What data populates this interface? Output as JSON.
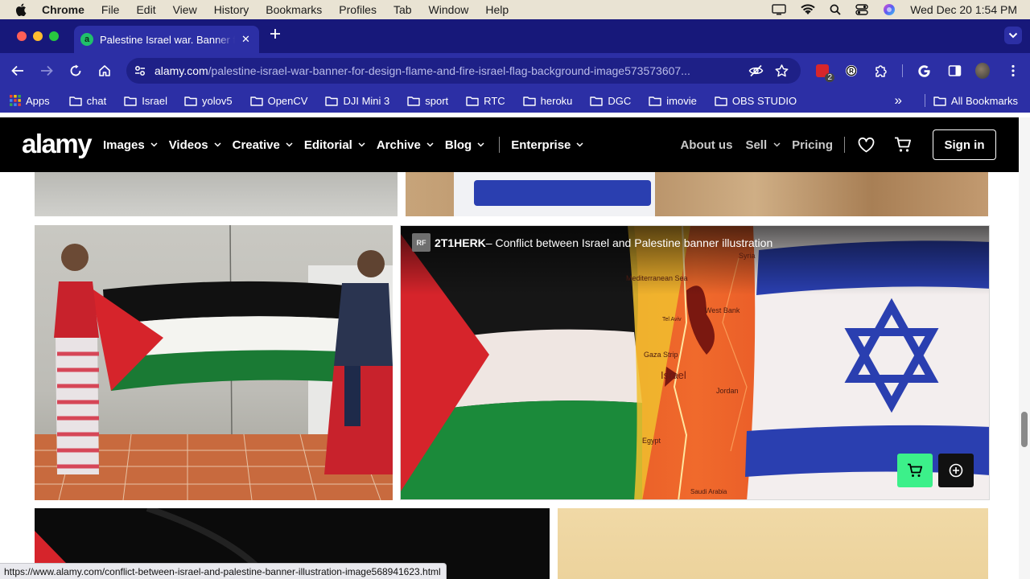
{
  "menubar": {
    "items": [
      "Chrome",
      "File",
      "Edit",
      "View",
      "History",
      "Bookmarks",
      "Profiles",
      "Tab",
      "Window",
      "Help"
    ],
    "clock": "Wed Dec 20  1:54 PM"
  },
  "tab": {
    "favicon": "a",
    "title": "Palestine Israel war. Banner for design",
    "close": "✕"
  },
  "omnibox": {
    "domain": "alamy.com",
    "path": "/palestine-israel-war-banner-for-design-flame-and-fire-israel-flag-background-image573573607..."
  },
  "extensions": {
    "badge_count": "2"
  },
  "bookmarks": {
    "apps_label": "Apps",
    "items": [
      "chat",
      "Israel",
      "yolov5",
      "OpenCV",
      "DJI Mini 3",
      "sport",
      "RTC",
      "heroku",
      "DGC",
      "imovie",
      "OBS STUDIO"
    ],
    "overflow": "»",
    "all_label": "All Bookmarks"
  },
  "site": {
    "logo": "alamy",
    "nav": [
      "Images",
      "Videos",
      "Creative",
      "Editorial",
      "Archive",
      "Blog"
    ],
    "enterprise": "Enterprise",
    "about": "About us",
    "sell": "Sell",
    "pricing": "Pricing",
    "signin": "Sign in"
  },
  "featured": {
    "badge": "RF",
    "image_id": "2T1HERK",
    "caption": " – Conflict between Israel and Palestine banner illustration",
    "map_labels": [
      "Syria",
      "Mediterranean Sea",
      "Tel Aviv",
      "West Bank",
      "Gaza Strip",
      "Israel",
      "Jordan",
      "Egypt",
      "Saudi Arabia"
    ]
  },
  "status_url": "https://www.alamy.com/conflict-between-israel-and-palestine-banner-illustration-image568941623.html",
  "colors": {
    "tab_strip": "#17187a",
    "toolbar": "#2c2fa5",
    "cart_button": "#3cf08a",
    "palestine_red": "#d6242b",
    "palestine_green": "#1a7a34",
    "israel_blue": "#2a3fb0"
  }
}
